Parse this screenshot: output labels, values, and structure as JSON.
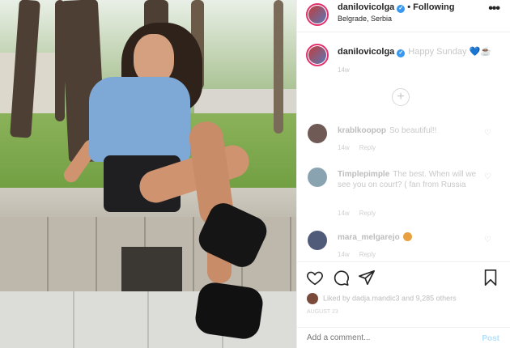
{
  "header": {
    "username": "danilovicolga",
    "separator": "•",
    "follow_label": "Following",
    "location": "Belgrade, Serbia",
    "more_icon": "more-horizontal-icon"
  },
  "caption": {
    "username": "danilovicolga",
    "text": "Happy Sunday",
    "emoji": "💙☕",
    "time": "14w"
  },
  "load_more": "+",
  "comments": [
    {
      "username": "krablkoopop",
      "text": "So beautiful!!",
      "time": "14w",
      "reply": "Reply"
    },
    {
      "username": "Timplepimple",
      "text": "The best. When will we see you on court? ( fan from Russia",
      "time": "14w",
      "reply": "Reply"
    },
    {
      "username": "mara_melgarejo",
      "text": "",
      "time": "14w",
      "reply": "Reply"
    }
  ],
  "actions": {
    "like_icon": "heart-icon",
    "comment_icon": "comment-icon",
    "share_icon": "paper-plane-icon",
    "save_icon": "bookmark-icon"
  },
  "likes_text": "Liked by dadja.mandic3 and 9,285 others",
  "posted": "AUGUST 23",
  "add_comment": {
    "placeholder": "Add a comment...",
    "post_label": "Post"
  },
  "colors": {
    "verified": "#3897f0",
    "post_disabled": "#b2dffc",
    "story_ring": "#e1306c"
  }
}
